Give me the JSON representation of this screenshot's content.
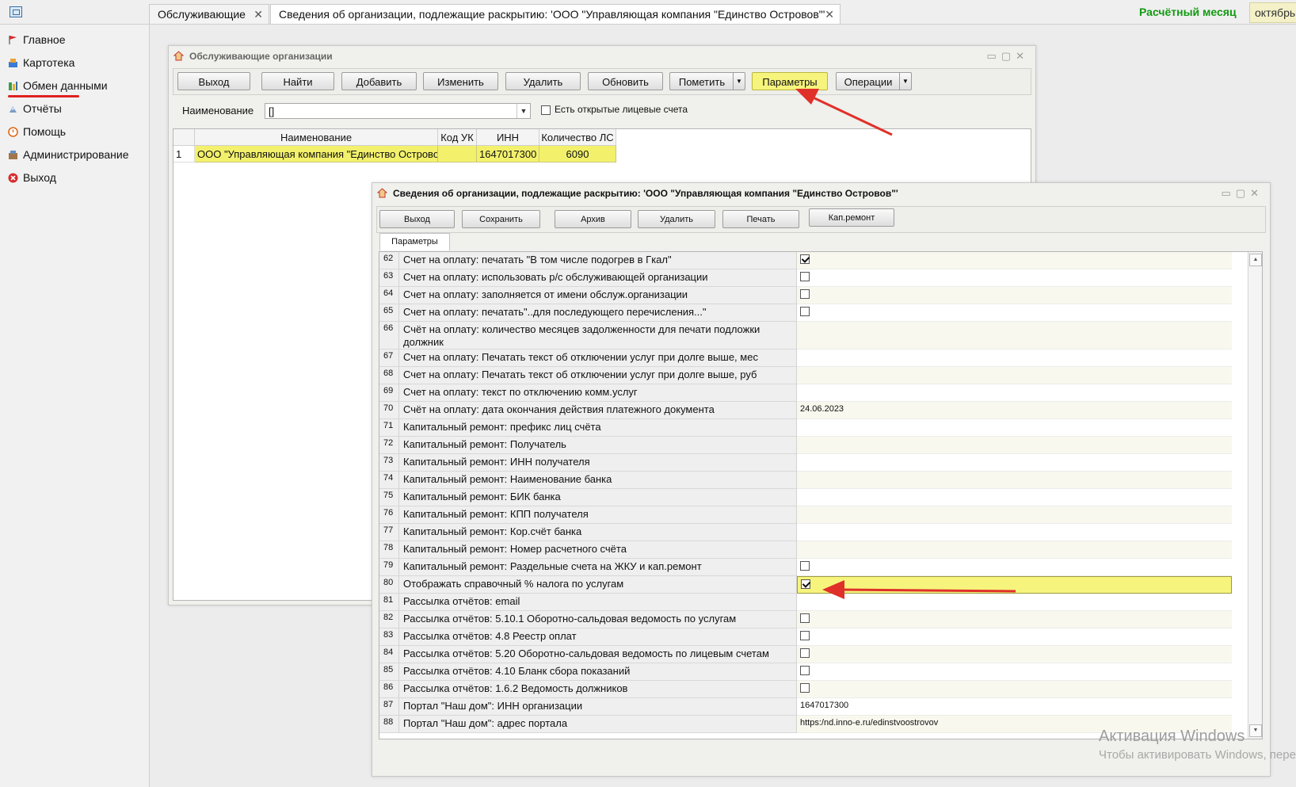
{
  "tabs": [
    {
      "label": "Обслуживающие"
    },
    {
      "label": "Сведения об организации, подлежащие раскрытию: 'ООО \"Управляющая компания \"Единство Островов\"'"
    }
  ],
  "header": {
    "month_label": "Расчётный месяц",
    "month_value": "октябрь"
  },
  "sidebar": {
    "items": [
      {
        "label": "Главное"
      },
      {
        "label": "Картотека"
      },
      {
        "label": "Обмен данными"
      },
      {
        "label": "Отчёты"
      },
      {
        "label": "Помощь"
      },
      {
        "label": "Администрирование"
      },
      {
        "label": "Выход"
      }
    ]
  },
  "win1": {
    "title": "Обслуживающие организации",
    "toolbar": {
      "exit": "Выход",
      "find": "Найти",
      "add": "Добавить",
      "edit": "Изменить",
      "delete": "Удалить",
      "refresh": "Обновить",
      "mark": "Пометить",
      "params": "Параметры",
      "operations": "Операции"
    },
    "filter": {
      "name_label": "Наименование",
      "name_value": "[]",
      "open_accounts_label": "Есть открытые лицевые счета"
    },
    "columns": [
      "Наименование",
      "Код УК",
      "ИНН",
      "Количество ЛС"
    ],
    "rows": [
      {
        "n": "1",
        "name": "ООО \"Управляющая компания \"Единство Островов\"",
        "code": "",
        "inn": "1647017300",
        "count": "6090"
      }
    ]
  },
  "win2": {
    "title": "Сведения об организации, подлежащие раскрытию: 'ООО \"Управляющая компания \"Единство Островов\"'",
    "toolbar": {
      "exit": "Выход",
      "save": "Сохранить",
      "archive": "Архив",
      "delete": "Удалить",
      "print": "Печать",
      "kap": "Кап.ремонт"
    },
    "tab": "Параметры",
    "rows": [
      {
        "n": "62",
        "name": "Счет на оплату: печатать \"В том числе подогрев в Гкал\"",
        "checkbox": true,
        "checked": true
      },
      {
        "n": "63",
        "name": "Счет на оплату: использовать р/с обслуживающей организации",
        "checkbox": true,
        "checked": false
      },
      {
        "n": "64",
        "name": "Счет на оплату: заполняется от имени обслуж.организации",
        "checkbox": true,
        "checked": false
      },
      {
        "n": "65",
        "name": "Счет на оплату: печатать\"..для последующего перечисления...\"",
        "checkbox": true,
        "checked": false
      },
      {
        "n": "66",
        "name": "Счёт на оплату: количество месяцев задолженности для печати подложки должник",
        "value": ""
      },
      {
        "n": "67",
        "name": "Счет на оплату: Печатать текст об отключении услуг при долге выше, мес",
        "value": ""
      },
      {
        "n": "68",
        "name": "Счет на оплату: Печатать текст об отключении услуг при долге выше, руб",
        "value": ""
      },
      {
        "n": "69",
        "name": "Счет на оплату: текст по отключению комм.услуг",
        "value": ""
      },
      {
        "n": "70",
        "name": "Счёт на оплату: дата окончания действия платежного документа",
        "value": "24.06.2023"
      },
      {
        "n": "71",
        "name": "Капитальный ремонт: префикс лиц счёта",
        "value": ""
      },
      {
        "n": "72",
        "name": "Капитальный ремонт: Получатель",
        "value": ""
      },
      {
        "n": "73",
        "name": "Капитальный ремонт: ИНН получателя",
        "value": ""
      },
      {
        "n": "74",
        "name": "Капитальный ремонт: Наименование банка",
        "value": ""
      },
      {
        "n": "75",
        "name": "Капитальный ремонт: БИК банка",
        "value": ""
      },
      {
        "n": "76",
        "name": "Капитальный ремонт: КПП получателя",
        "value": ""
      },
      {
        "n": "77",
        "name": "Капитальный ремонт: Кор.счёт банка",
        "value": ""
      },
      {
        "n": "78",
        "name": "Капитальный ремонт: Номер расчетного счёта",
        "value": ""
      },
      {
        "n": "79",
        "name": "Капитальный ремонт: Раздельные счета на ЖКУ и кап.ремонт",
        "checkbox": true,
        "checked": false
      },
      {
        "n": "80",
        "name": "Отображать справочный % налога по услугам",
        "checkbox": true,
        "checked": true,
        "highlight": true
      },
      {
        "n": "81",
        "name": "Рассылка отчётов: email",
        "value": ""
      },
      {
        "n": "82",
        "name": "Рассылка отчётов: 5.10.1 Оборотно-сальдовая ведомость по услугам",
        "checkbox": true,
        "checked": false
      },
      {
        "n": "83",
        "name": "Рассылка отчётов: 4.8 Реестр оплат",
        "checkbox": true,
        "checked": false
      },
      {
        "n": "84",
        "name": "Рассылка отчётов: 5.20 Оборотно-сальдовая ведомость по лицевым счетам",
        "checkbox": true,
        "checked": false
      },
      {
        "n": "85",
        "name": "Рассылка отчётов: 4.10 Бланк сбора показаний",
        "checkbox": true,
        "checked": false
      },
      {
        "n": "86",
        "name": "Рассылка отчётов: 1.6.2 Ведомость должников",
        "checkbox": true,
        "checked": false
      },
      {
        "n": "87",
        "name": "Портал \"Наш дом\": ИНН организации",
        "value": "1647017300"
      },
      {
        "n": "88",
        "name": "Портал \"Наш дом\": адрес портала",
        "value": "https:/nd.inno-e.ru/edinstvoostrovov"
      }
    ]
  },
  "watermark": {
    "line1": "Активация Windows",
    "line2": "Чтобы активировать Windows, пере"
  },
  "colors": {
    "highlight": "#f6f47c",
    "accent_green": "#119a11",
    "arrow_red": "#e0302a"
  }
}
